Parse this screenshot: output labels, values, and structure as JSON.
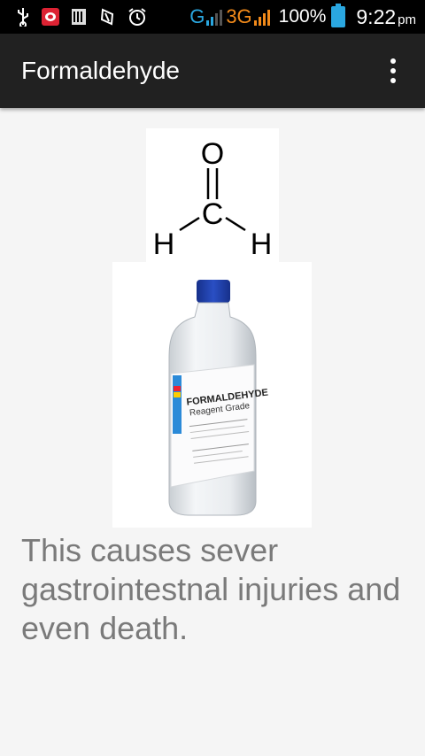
{
  "status_bar": {
    "icons": [
      "usb-icon",
      "notification-app-icon",
      "sim-icon",
      "nfc-icon",
      "alarm-icon"
    ],
    "network_1": "G",
    "network_2": "3G",
    "battery_percent": "100%",
    "time": "9:22",
    "ampm": "pm",
    "colors": {
      "orange": "#f28a1a",
      "blue": "#2aa7e0"
    }
  },
  "app_bar": {
    "title": "Formaldehyde",
    "menu_icon": "more-vert-icon"
  },
  "structure": {
    "atoms": {
      "oxygen": "O",
      "carbon": "C",
      "hydrogen_left": "H",
      "hydrogen_right": "H"
    }
  },
  "bottle": {
    "label_title": "FORMALDEHYDE",
    "label_subtitle": "Reagent Grade",
    "cap_color": "#1f3fa8"
  },
  "content": {
    "description": "This causes sever gastrointestnal injuries and even death."
  }
}
